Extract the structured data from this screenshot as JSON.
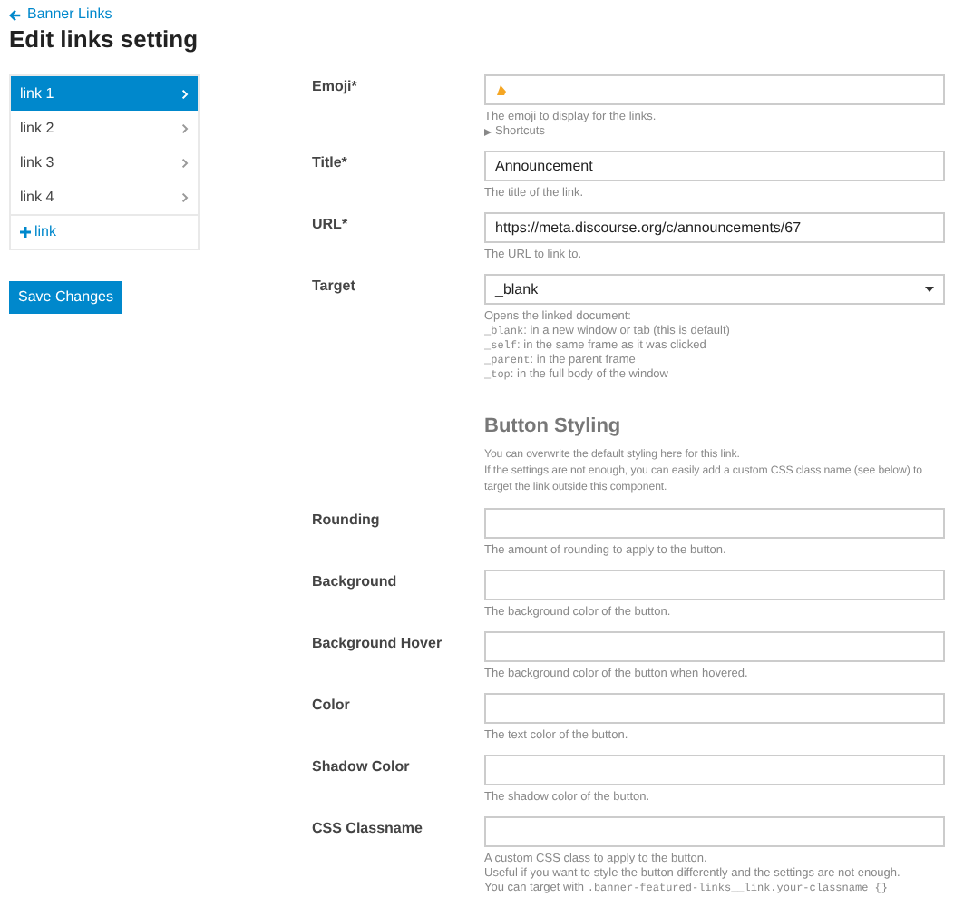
{
  "back_link": "Banner Links",
  "title": "Edit links setting",
  "sidebar": {
    "items": [
      {
        "label": "link 1",
        "selected": true
      },
      {
        "label": "link 2",
        "selected": false
      },
      {
        "label": "link 3",
        "selected": false
      },
      {
        "label": "link 4",
        "selected": false
      }
    ],
    "add_label": "link"
  },
  "save_button": "Save Changes",
  "form": [
    {
      "kind": "emoji",
      "label": "Emoji*",
      "hint": [
        [
          {
            "text": "The emoji to display for the links.",
            "kind": "text"
          }
        ]
      ],
      "disclosure": "Shortcuts"
    },
    {
      "kind": "text",
      "label": "Title*",
      "value": "Announcement",
      "hint": [
        [
          {
            "text": "The title of the link.",
            "kind": "text"
          }
        ]
      ]
    },
    {
      "kind": "text",
      "label": "URL*",
      "value": "https://meta.discourse.org/c/announcements/67",
      "hint": [
        [
          {
            "text": "The URL to link to.",
            "kind": "text"
          }
        ]
      ]
    },
    {
      "kind": "select",
      "label": "Target",
      "value": "_blank",
      "hint": [
        [
          {
            "text": "Opens the linked document:",
            "kind": "text"
          }
        ],
        [
          {
            "text": "_blank",
            "kind": "code"
          },
          {
            "text": ": in a new window or tab (this is default)",
            "kind": "text"
          }
        ],
        [
          {
            "text": "_self",
            "kind": "code"
          },
          {
            "text": ": in the same frame as it was clicked",
            "kind": "text"
          }
        ],
        [
          {
            "text": "_parent",
            "kind": "code"
          },
          {
            "text": ": in the parent frame",
            "kind": "text"
          }
        ],
        [
          {
            "text": "_top",
            "kind": "code"
          },
          {
            "text": ": in the full body of the window",
            "kind": "text"
          }
        ]
      ]
    },
    {
      "kind": "section",
      "heading": "Button Styling",
      "description": [
        "You can overwrite the default styling here for this link.",
        "If the settings are not enough, you can easily add a custom CSS class name (see below) to",
        "target the link outside this component."
      ]
    },
    {
      "kind": "text",
      "label": "Rounding",
      "hint": [
        [
          {
            "text": "The amount of rounding to apply to the button.",
            "kind": "text"
          }
        ]
      ]
    },
    {
      "kind": "text",
      "label": "Background",
      "hint": [
        [
          {
            "text": "The background color of the button.",
            "kind": "text"
          }
        ]
      ]
    },
    {
      "kind": "text",
      "label": "Background Hover",
      "hint": [
        [
          {
            "text": "The background color of the button when hovered.",
            "kind": "text"
          }
        ]
      ]
    },
    {
      "kind": "text",
      "label": "Color",
      "hint": [
        [
          {
            "text": "The text color of the button.",
            "kind": "text"
          }
        ]
      ]
    },
    {
      "kind": "text",
      "label": "Shadow Color",
      "hint": [
        [
          {
            "text": "The shadow color of the button.",
            "kind": "text"
          }
        ]
      ]
    },
    {
      "kind": "text",
      "label": "CSS Classname",
      "hint": [
        [
          {
            "text": "A custom CSS class to apply to the button.",
            "kind": "text"
          }
        ],
        [
          {
            "text": "Useful if you want to style the button differently and the settings are not enough.",
            "kind": "text"
          }
        ],
        [
          {
            "text": "You can target with ",
            "kind": "text"
          },
          {
            "text": ".banner-featured-links__link.your-classname {}",
            "kind": "code"
          }
        ]
      ]
    }
  ]
}
